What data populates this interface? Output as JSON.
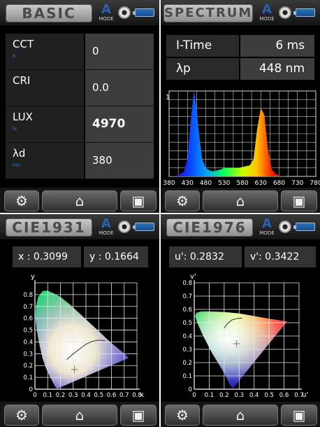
{
  "basic": {
    "title": "BASIC",
    "mode_letter": "A",
    "mode_label": "MODE",
    "rows": [
      {
        "label": "CCT",
        "unit": "K",
        "value": "0"
      },
      {
        "label": "CRI",
        "unit": "",
        "value": "0.0"
      },
      {
        "label": "LUX",
        "unit": "lx",
        "value": "4970"
      },
      {
        "label": "λd",
        "unit": "nm",
        "value": "380"
      }
    ]
  },
  "spectrum": {
    "title": "SPECTRUM",
    "mode_letter": "A",
    "mode_label": "MODE",
    "itime_label": "I-Time",
    "itime_value": "6 ms",
    "peak_label": "λp",
    "peak_value": "448 nm",
    "y_max_label": "1",
    "x_ticks": [
      "380",
      "430",
      "480",
      "530",
      "580",
      "630",
      "680",
      "730",
      "780"
    ]
  },
  "cie1931": {
    "title": "CIE1931",
    "mode_letter": "A",
    "mode_label": "MODE",
    "x_label": "x : 0.3099",
    "y_label": "y : 0.1664",
    "axis_x_name": "x",
    "axis_y_name": "y",
    "x_ticks": [
      "0",
      "0.1",
      "0.2",
      "0.3",
      "0.4",
      "0.5",
      "0.6",
      "0.7",
      "0.8"
    ],
    "y_ticks": [
      "0",
      "0.1",
      "0.2",
      "0.3",
      "0.4",
      "0.5",
      "0.6",
      "0.7",
      "0.8"
    ]
  },
  "cie1976": {
    "title": "CIE1976",
    "mode_letter": "A",
    "mode_label": "MODE",
    "u_label": "u': 0.2832",
    "v_label": "v': 0.3422",
    "axis_x_name": "u'",
    "axis_y_name": "v'",
    "x_ticks": [
      "0",
      "0.1",
      "0.2",
      "0.3",
      "0.4",
      "0.5",
      "0.6",
      "0.7"
    ],
    "y_ticks": [
      "0",
      "0.1",
      "0.2",
      "0.3",
      "0.4",
      "0.5",
      "0.6",
      "0.7",
      "0.8"
    ]
  },
  "icons": {
    "settings": "gear-icon",
    "home": "home-icon",
    "save": "save-icon",
    "battery": "battery-icon"
  },
  "chart_data": [
    {
      "type": "area",
      "x": [
        380,
        400,
        420,
        430,
        440,
        448,
        455,
        460,
        470,
        480,
        490,
        500,
        510,
        520,
        530,
        540,
        550,
        560,
        570,
        580,
        590,
        600,
        610,
        620,
        630,
        640,
        645,
        650,
        660,
        670,
        680,
        700,
        730,
        780
      ],
      "values": [
        0,
        0.01,
        0.05,
        0.2,
        0.7,
        1.0,
        0.8,
        0.55,
        0.2,
        0.1,
        0.07,
        0.06,
        0.07,
        0.08,
        0.1,
        0.1,
        0.1,
        0.1,
        0.1,
        0.11,
        0.12,
        0.13,
        0.2,
        0.55,
        0.8,
        0.72,
        0.5,
        0.3,
        0.08,
        0.03,
        0.01,
        0,
        0,
        0
      ],
      "ylim": [
        0,
        1
      ],
      "xlim": [
        380,
        780
      ]
    },
    {
      "type": "scatter",
      "x": [
        0.3099
      ],
      "y": [
        0.1664
      ],
      "xlim": [
        0,
        0.8
      ],
      "ylim": [
        0,
        0.9
      ]
    },
    {
      "type": "scatter",
      "x": [
        0.2832
      ],
      "y": [
        0.3422
      ],
      "xlim": [
        0,
        0.7
      ],
      "ylim": [
        0,
        0.8
      ]
    }
  ]
}
